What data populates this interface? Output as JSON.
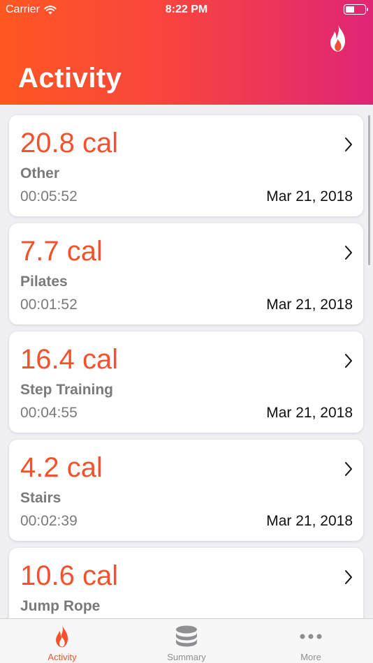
{
  "status_bar": {
    "carrier": "Carrier",
    "time": "8:22 PM",
    "battery_level": 0.45
  },
  "header": {
    "title": "Activity",
    "icon": "flame-icon"
  },
  "activities": [
    {
      "calories": "20.8 cal",
      "type": "Other",
      "duration": "00:05:52",
      "date": "Mar 21, 2018"
    },
    {
      "calories": "7.7 cal",
      "type": "Pilates",
      "duration": "00:01:52",
      "date": "Mar 21, 2018"
    },
    {
      "calories": "16.4 cal",
      "type": "Step Training",
      "duration": "00:04:55",
      "date": "Mar 21, 2018"
    },
    {
      "calories": "4.2 cal",
      "type": "Stairs",
      "duration": "00:02:39",
      "date": "Mar 21, 2018"
    },
    {
      "calories": "10.6 cal",
      "type": "Jump Rope",
      "duration": "",
      "date": ""
    }
  ],
  "tabs": [
    {
      "label": "Activity",
      "icon": "flame-icon",
      "active": true
    },
    {
      "label": "Summary",
      "icon": "database-icon",
      "active": false
    },
    {
      "label": "More",
      "icon": "more-icon",
      "active": false
    }
  ],
  "colors": {
    "accent": "#f4512c",
    "gradient_start": "#ff5722",
    "gradient_end": "#df2576",
    "inactive": "#8e8e93"
  }
}
